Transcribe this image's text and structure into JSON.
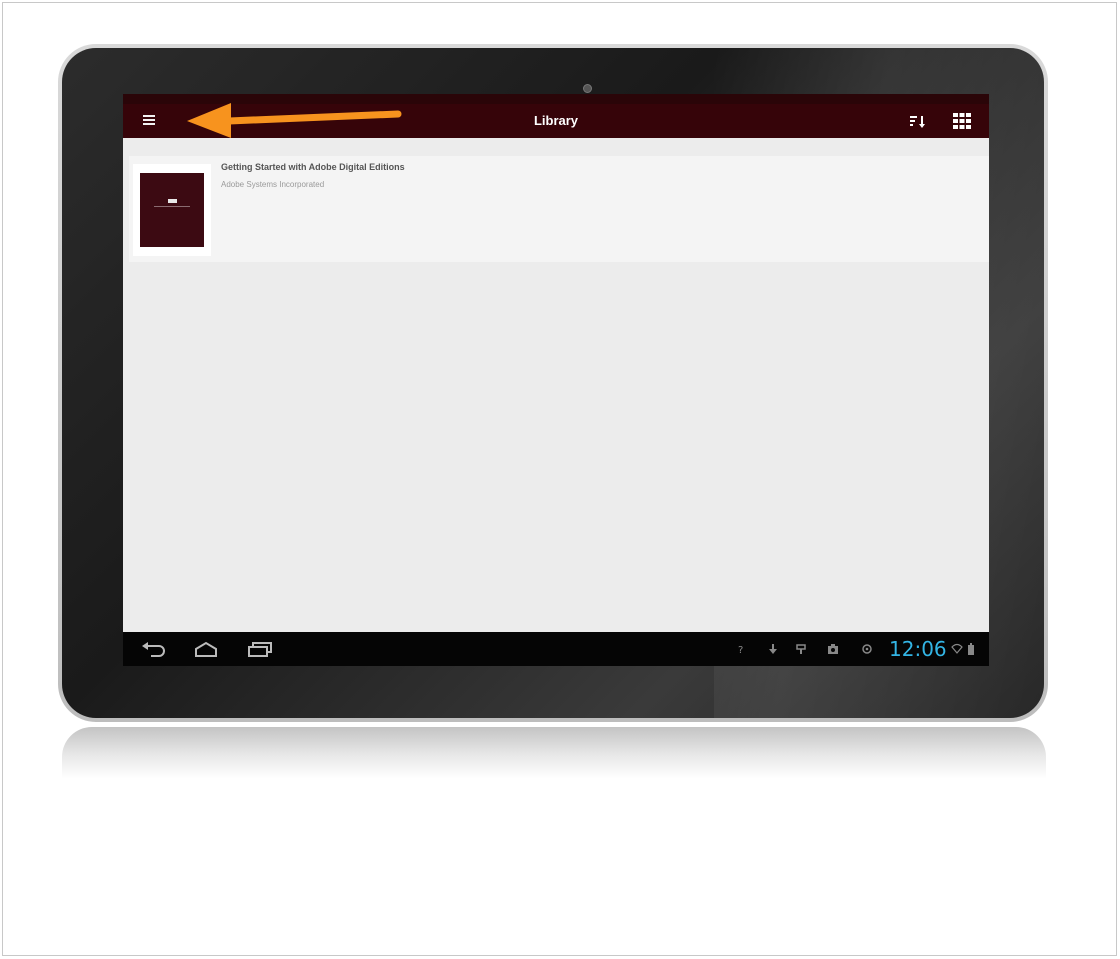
{
  "app": {
    "title": "Library"
  },
  "library": {
    "books": [
      {
        "title": "Getting Started with Adobe Digital Editions",
        "author": "Adobe Systems Incorporated"
      }
    ]
  },
  "system_bar": {
    "clock": "12:06"
  },
  "icons": {
    "menu": "hamburger-menu-icon",
    "sort": "sort-icon",
    "grid": "grid-view-icon",
    "back": "back-icon",
    "home": "home-icon",
    "recents": "recent-apps-icon"
  },
  "colors": {
    "action_bar": "#360409",
    "accent_clock": "#33b5e5",
    "annotation_arrow": "#f7931e"
  }
}
